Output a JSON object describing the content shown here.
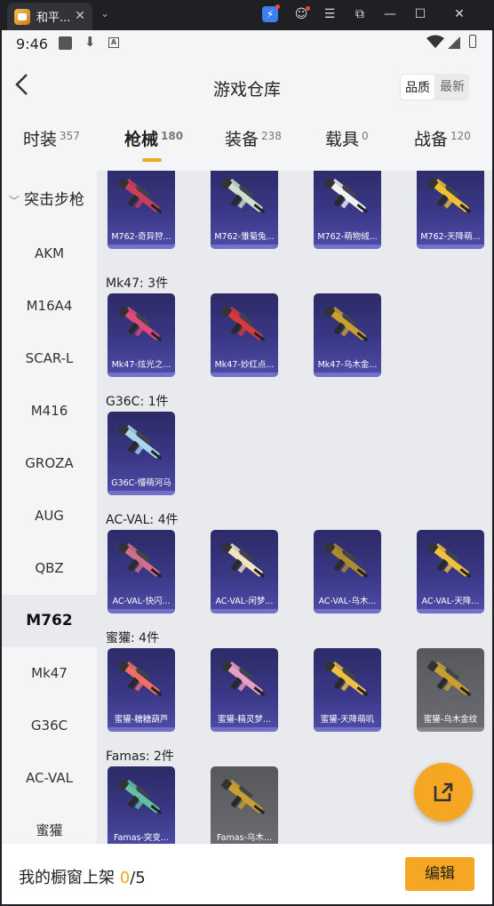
{
  "window": {
    "tab_title": "和平...",
    "close_glyph": "✕",
    "dropdown_glyph": "⌄",
    "controls": [
      "⚡",
      "☺",
      "☰",
      "⧉",
      "—",
      "☐",
      "✕"
    ]
  },
  "statusbar": {
    "time": "9:46",
    "a_badge": "A"
  },
  "header": {
    "title": "游戏仓库",
    "sort_options": [
      "品质",
      "最新"
    ],
    "active_sort": "品质"
  },
  "categories": [
    {
      "label": "时装",
      "count": "357"
    },
    {
      "label": "枪械",
      "count": "180"
    },
    {
      "label": "装备",
      "count": "238"
    },
    {
      "label": "载具",
      "count": "0"
    },
    {
      "label": "战备",
      "count": "120"
    }
  ],
  "sidebar": {
    "header": "突击步枪",
    "items": [
      "AKM",
      "M16A4",
      "SCAR-L",
      "M416",
      "GROZA",
      "AUG",
      "QBZ",
      "M762",
      "Mk47",
      "G36C",
      "AC-VAL",
      "蜜獾"
    ],
    "active": "M762"
  },
  "groups": [
    {
      "title": "",
      "items": [
        {
          "label": "M762-奇异狩...",
          "color": "#c9405a",
          "grey": false
        },
        {
          "label": "M762-雏菊兔...",
          "color": "#cfe0c8",
          "grey": false
        },
        {
          "label": "M762-萌物绒...",
          "color": "#f2f2f2",
          "grey": false
        },
        {
          "label": "M762-天降萌...",
          "color": "#f0c030",
          "grey": false
        }
      ]
    },
    {
      "title": "Mk47: 3件",
      "items": [
        {
          "label": "Mk47-炫光之...",
          "color": "#e04a7a",
          "grey": false
        },
        {
          "label": "Mk47-妙红点...",
          "color": "#d83a3a",
          "grey": false
        },
        {
          "label": "Mk47-乌木金...",
          "color": "#c9a030",
          "grey": false
        }
      ]
    },
    {
      "title": "G36C: 1件",
      "items": [
        {
          "label": "G36C-懵萌河马",
          "color": "#a9d6e8",
          "grey": false
        }
      ]
    },
    {
      "title": "AC-VAL: 4件",
      "items": [
        {
          "label": "AC-VAL-快闪...",
          "color": "#d07088",
          "grey": false
        },
        {
          "label": "AC-VAL-闲梦...",
          "color": "#f0e6c0",
          "grey": false
        },
        {
          "label": "AC-VAL-乌木...",
          "color": "#b08a30",
          "grey": false
        },
        {
          "label": "AC-VAL-天降...",
          "color": "#f0c040",
          "grey": false
        }
      ]
    },
    {
      "title": "蜜獾: 4件",
      "items": [
        {
          "label": "蜜獾-糖糖葫芦",
          "color": "#f07060",
          "grey": false
        },
        {
          "label": "蜜獾-精灵梦...",
          "color": "#e8a0c0",
          "grey": false
        },
        {
          "label": "蜜獾-天降萌叽",
          "color": "#f0c040",
          "grey": false
        },
        {
          "label": "蜜獾-乌木金纹",
          "color": "#c9a030",
          "grey": true
        }
      ]
    },
    {
      "title": "Famas: 2件",
      "items": [
        {
          "label": "Famas-突变...",
          "color": "#60c0a0",
          "grey": false
        },
        {
          "label": "Famas-乌木...",
          "color": "#c9a030",
          "grey": true
        }
      ]
    }
  ],
  "footer": {
    "label": "我的橱窗上架",
    "current": "0",
    "total": "/5",
    "button": "编辑"
  }
}
